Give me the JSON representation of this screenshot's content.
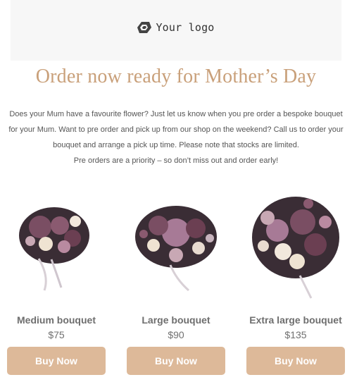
{
  "header": {
    "logo_text": "Your logo"
  },
  "headline": "Order now ready for Mother’s Day",
  "intro": {
    "paragraph": "Does your Mum have a favourite flower? Just let us know when you pre order a bespoke bouquet for your Mum. Want to pre order and pick up from our shop on the weekend? Call us to order your bouquet and arrange a pick up time. Please note that stocks are limited.",
    "closing": "Pre orders are a priority – so don’t miss out and order early!"
  },
  "products": [
    {
      "name": "Medium bouquet",
      "price": "$75",
      "button": "Buy Now"
    },
    {
      "name": "Large bouquet",
      "price": "$90",
      "button": "Buy Now"
    },
    {
      "name": "Extra large bouquet",
      "price": "$135",
      "button": "Buy Now"
    }
  ],
  "colors": {
    "accent": "#ddb999",
    "headline": "#c9a07a",
    "header_bg": "#f7f7f7"
  }
}
